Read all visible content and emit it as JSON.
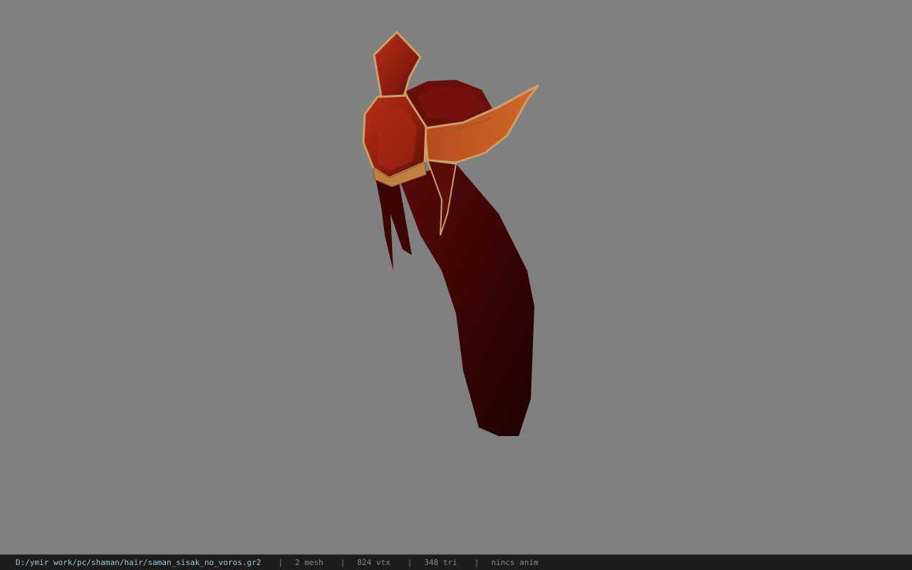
{
  "viewport": {
    "background_color": "#808080",
    "model": {
      "description_icon": "helmet-hair-model",
      "colors": {
        "hair_dark": "#2a0404",
        "hair_mid": "#6a0e0a",
        "armor_red": "#9a2412",
        "armor_gold": "#c8a060"
      }
    }
  },
  "status_bar": {
    "file_path": "D:/ymir work/pc/shaman/hair/saman_sisak_no_voros.gr2",
    "mesh_count": "2 mesh",
    "vertex_count": "824 vtx",
    "triangle_count": "348 tri",
    "animation_status": "nincs anim",
    "separator": "|",
    "path_color": "#9fc8dc",
    "text_color": "#8a8a8a"
  }
}
